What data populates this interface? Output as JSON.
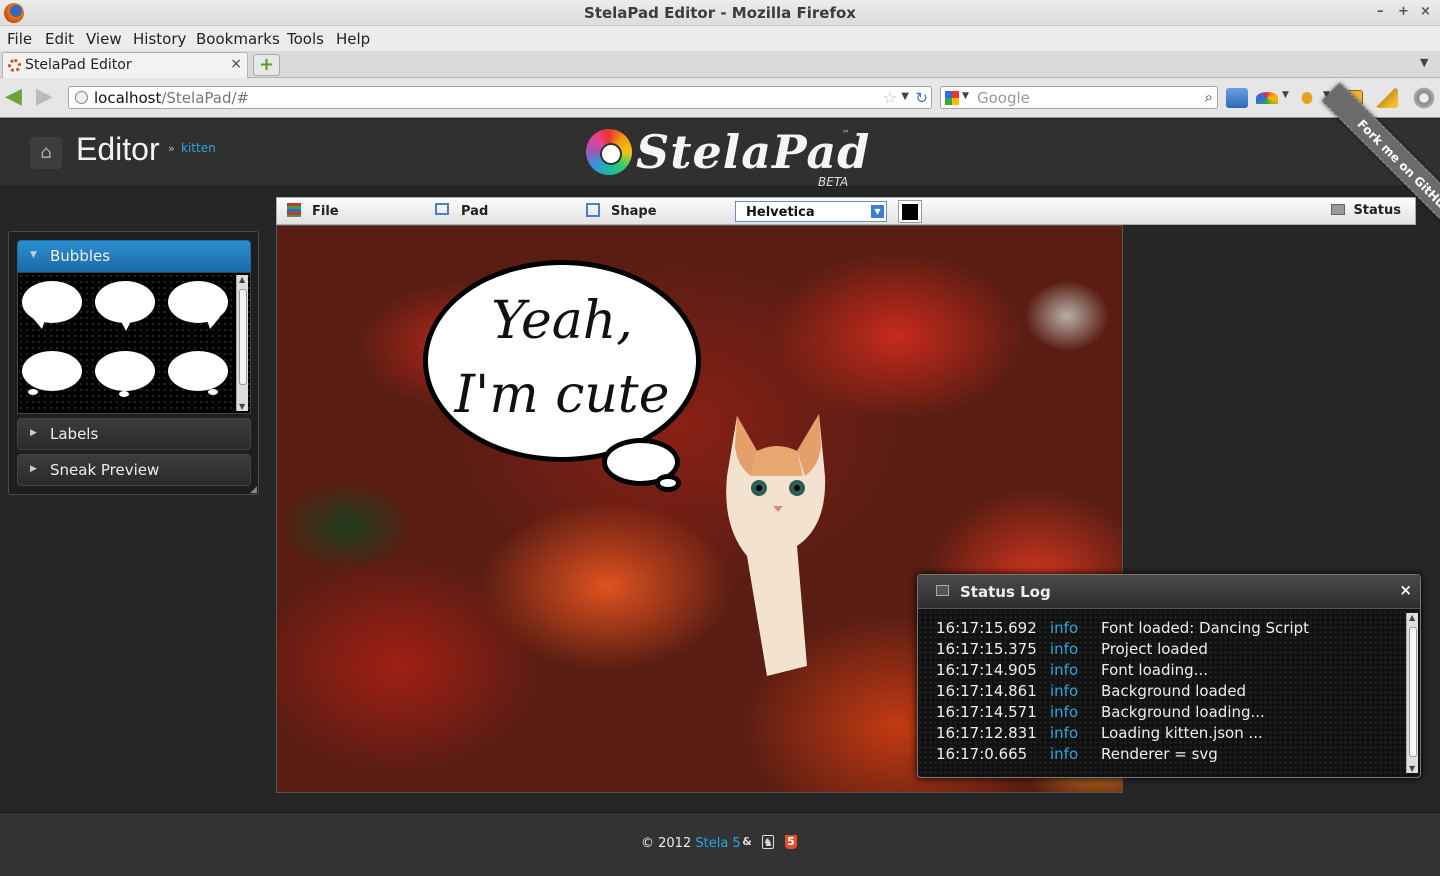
{
  "window": {
    "title": "StelaPad Editor - Mozilla Firefox",
    "controls": {
      "minimize": "–",
      "maximize": "+",
      "close": "×"
    }
  },
  "menubar": {
    "items": [
      "File",
      "Edit",
      "View",
      "History",
      "Bookmarks",
      "Tools",
      "Help"
    ]
  },
  "tabs": [
    {
      "label": "StelaPad Editor",
      "close": "×"
    }
  ],
  "newtab_label": "+",
  "navbar": {
    "url_host": "localhost",
    "url_path": "/StelaPad/#",
    "search_placeholder": "Google"
  },
  "header": {
    "title": "Editor",
    "separator": "»",
    "breadcrumb": "kitten",
    "logo_text": "StelaPad",
    "logo_tm": "™",
    "logo_beta": "BETA",
    "fork_ribbon": "Fork me on GitHub"
  },
  "sidebar": {
    "sections": [
      {
        "label": "Bubbles",
        "expanded": true
      },
      {
        "label": "Labels",
        "expanded": false
      },
      {
        "label": "Sneak Preview",
        "expanded": false
      }
    ],
    "accent": "#2d8fd0"
  },
  "toolbar": {
    "file": "File",
    "pad": "Pad",
    "shape": "Shape",
    "font_value": "Helvetica",
    "color_value": "#000000",
    "status": "Status"
  },
  "canvas": {
    "bubble_line1": "Yeah,",
    "bubble_line2": "I'm cute"
  },
  "status_log": {
    "title": "Status Log",
    "close": "×",
    "rows": [
      {
        "time": "16:17:15.692",
        "level": "info",
        "message": "Font loaded: Dancing Script"
      },
      {
        "time": "16:17:15.375",
        "level": "info",
        "message": "Project loaded"
      },
      {
        "time": "16:17:14.905",
        "level": "info",
        "message": "Font loading..."
      },
      {
        "time": "16:17:14.861",
        "level": "info",
        "message": "Background loaded"
      },
      {
        "time": "16:17:14.571",
        "level": "info",
        "message": "Background loading..."
      },
      {
        "time": "16:17:12.831",
        "level": "info",
        "message": "Loading kitten.json ..."
      },
      {
        "time": "16:17:0.665",
        "level": "info",
        "message": "Renderer = svg"
      }
    ],
    "level_color": "#2aa7e0"
  },
  "footer": {
    "copyright": "© 2012",
    "brand": "Stela 5",
    "icons": [
      "github-icon",
      "octocat-icon",
      "html5-icon"
    ]
  }
}
